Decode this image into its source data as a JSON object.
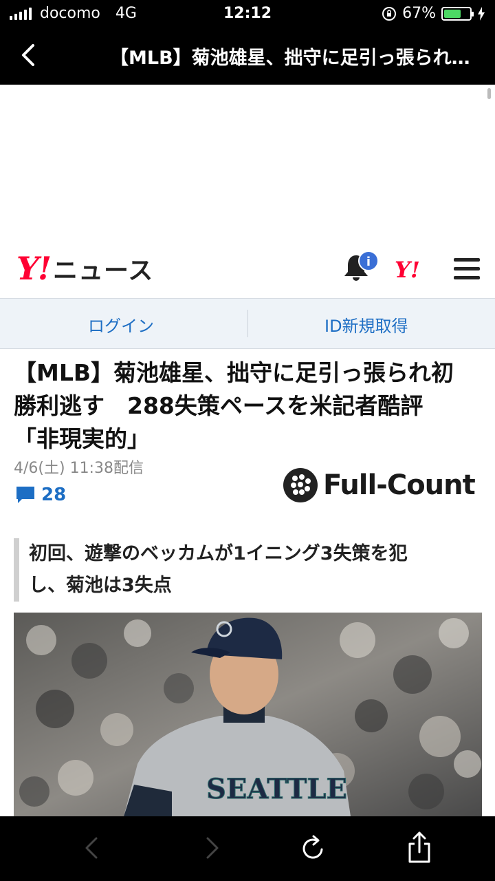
{
  "status_bar": {
    "carrier": "docomo",
    "network": "4G",
    "time": "12:12",
    "battery_percent": "67%",
    "battery_level": 0.67,
    "battery_color": "#4cd964"
  },
  "nav": {
    "title": "【MLB】菊池雄星、拙守に足引っ張られ初…",
    "back_icon": "chevron-left-icon"
  },
  "yahoo_header": {
    "logo_y": "Y!",
    "logo_text": "ニュース",
    "notification_badge": "i",
    "yahoo_mini": "Y!",
    "brand_color": "#ff0033"
  },
  "login_bar": {
    "login_label": "ログイン",
    "register_label": "ID新規取得",
    "link_color": "#1d6ec4"
  },
  "article": {
    "headline_lines": [
      "【MLB】菊池雄星、拙守に足引っ張られ初",
      "勝利逃す　288失策ペースを米記者酷評",
      "「非現実的」"
    ],
    "date": "4/6(土) 11:38配信",
    "comment_count": "28",
    "source_logo": "Full-Count",
    "subhead_lines": [
      "初回、遊撃のベッカムが1イニング3失策を犯",
      "し、菊池は3失点"
    ]
  },
  "toolbar": {
    "back": "back-arrow-icon",
    "forward": "forward-arrow-icon",
    "reload": "reload-icon",
    "share": "share-icon"
  }
}
